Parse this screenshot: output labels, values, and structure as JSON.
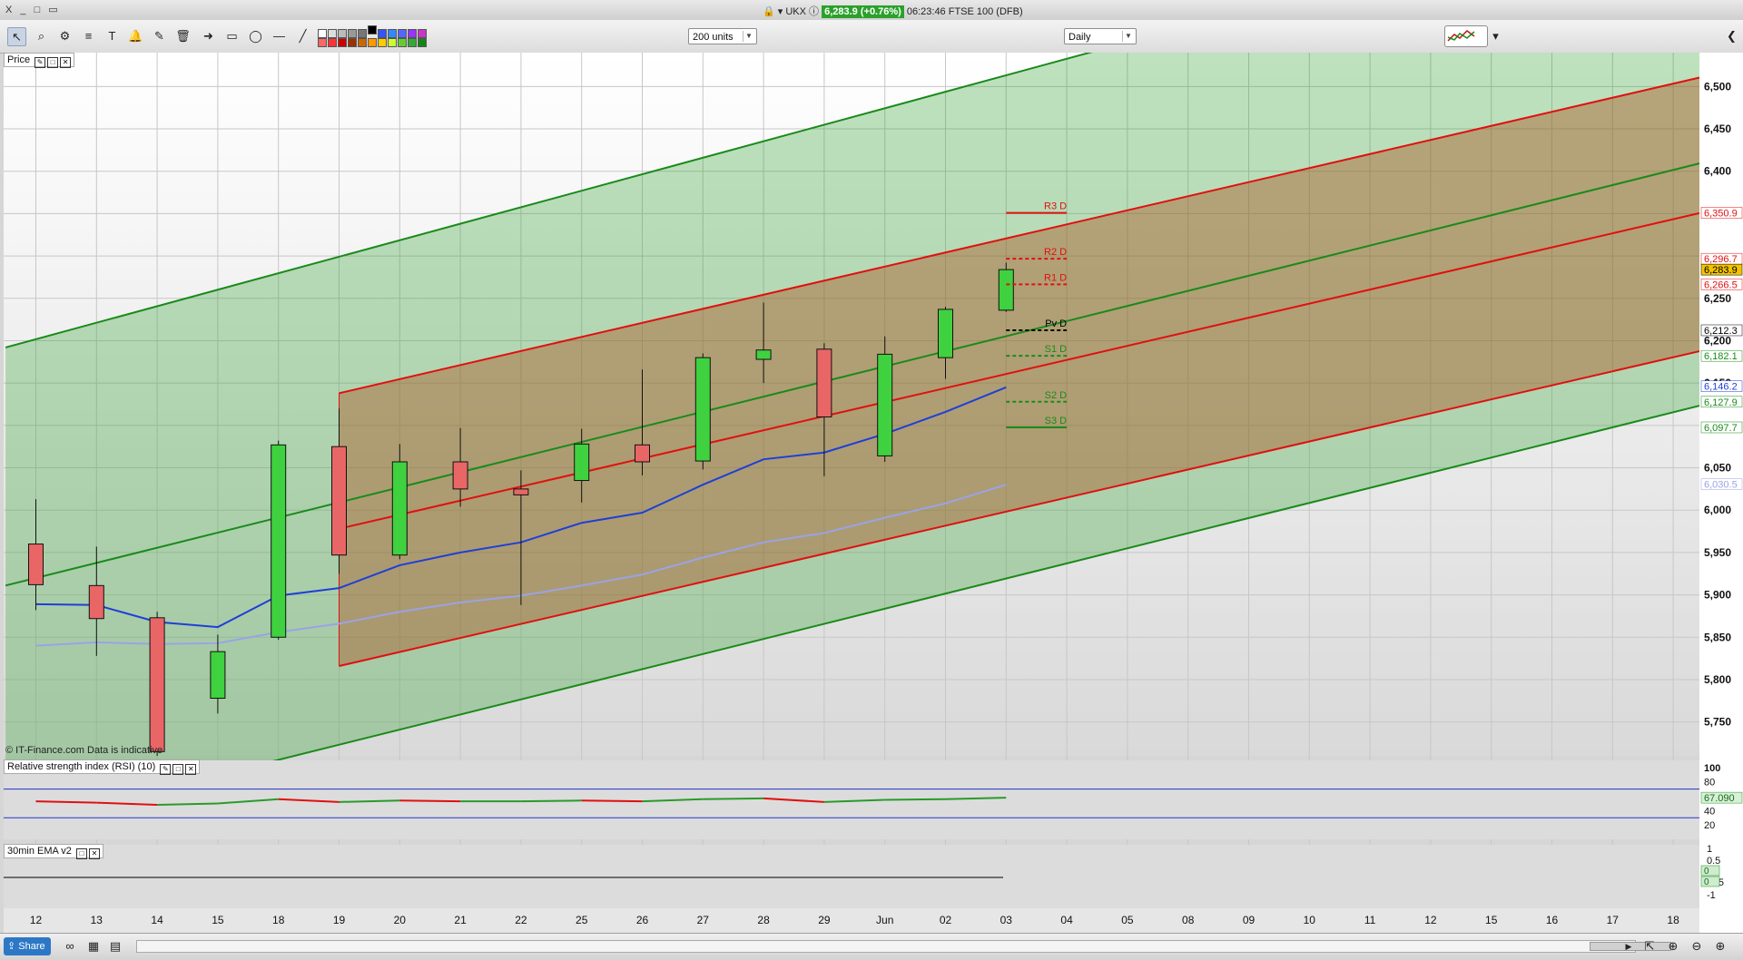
{
  "window": {
    "controls": "X _ □ ▭",
    "symbol": "UKX",
    "price_badge": "6,283.9 (+0.76%)",
    "clock_instrument": "06:23:46 FTSE 100 (DFB)"
  },
  "toolbar": {
    "units_select": "200 units",
    "interval_select": "Daily"
  },
  "panels": {
    "price_label": "Price",
    "rsi_label": "Relative strength index (RSI) (10)",
    "ema_label": "30min EMA v2",
    "copyright": "© IT-Finance.com  Data is indicative"
  },
  "bottom": {
    "share_label": "Share"
  },
  "colors": {
    "up": "#3fd13f",
    "down": "#e86666",
    "channel_red": "#e01010",
    "channel_green": "#1a8a1a",
    "ema_fast": "#1f3fd6",
    "ema_slow": "#9aa3e6",
    "rsi_up": "#2a9a2a",
    "rsi_down": "#e01010"
  },
  "chart_data": {
    "type": "candlestick",
    "x_ticks": [
      "12",
      "13",
      "14",
      "15",
      "18",
      "19",
      "20",
      "21",
      "22",
      "25",
      "26",
      "27",
      "28",
      "29",
      "Jun",
      "02",
      "03",
      "04",
      "05",
      "08",
      "09",
      "10",
      "11",
      "12",
      "15",
      "16",
      "17",
      "18"
    ],
    "y_ticks": [
      5750,
      5800,
      5850,
      5900,
      5950,
      6000,
      6050,
      6100,
      6150,
      6200,
      6250,
      6300,
      6350,
      6400,
      6450,
      6500
    ],
    "y_tick_labels": [
      "5,750",
      "5,800",
      "5,850",
      "5,900",
      "5,950",
      "6,000",
      "6,050",
      "",
      "6,150",
      "6,200",
      "6,250",
      "",
      "",
      "6,400",
      "6,450",
      "6,500"
    ],
    "ylim": [
      5710,
      6540
    ],
    "candles": [
      {
        "x": "12",
        "open": 5960,
        "high": 6013,
        "low": 5882,
        "close": 5912
      },
      {
        "x": "13",
        "open": 5911,
        "high": 5957,
        "low": 5828,
        "close": 5872
      },
      {
        "x": "14",
        "open": 5873,
        "high": 5880,
        "low": 5710,
        "close": 5715
      },
      {
        "x": "15",
        "open": 5778,
        "high": 5853,
        "low": 5760,
        "close": 5833
      },
      {
        "x": "18",
        "open": 5850,
        "high": 6082,
        "low": 5847,
        "close": 6077
      },
      {
        "x": "19",
        "open": 6075,
        "high": 6120,
        "low": 5925,
        "close": 5947
      },
      {
        "x": "20",
        "open": 5947,
        "high": 6078,
        "low": 5942,
        "close": 6057
      },
      {
        "x": "21",
        "open": 6057,
        "high": 6097,
        "low": 6004,
        "close": 6025
      },
      {
        "x": "22",
        "open": 6025,
        "high": 6047,
        "low": 5888,
        "close": 6018
      },
      {
        "x": "25",
        "open": 6035,
        "high": 6096,
        "low": 6009,
        "close": 6078
      },
      {
        "x": "26",
        "open": 6077,
        "high": 6166,
        "low": 6041,
        "close": 6057
      },
      {
        "x": "27",
        "open": 6058,
        "high": 6185,
        "low": 6048,
        "close": 6180
      },
      {
        "x": "28",
        "open": 6178,
        "high": 6245,
        "low": 6150,
        "close": 6189
      },
      {
        "x": "29",
        "open": 6190,
        "high": 6197,
        "low": 6040,
        "close": 6110
      },
      {
        "x": "Jun",
        "open": 6064,
        "high": 6205,
        "low": 6057,
        "close": 6184
      },
      {
        "x": "02",
        "open": 6180,
        "high": 6240,
        "low": 6155,
        "close": 6237
      },
      {
        "x": "03",
        "open": 6236,
        "high": 6292,
        "low": 6234,
        "close": 6283.9
      }
    ],
    "ema_fast": [
      5889,
      5888,
      5868,
      5862,
      5899,
      5908,
      5935,
      5950,
      5962,
      5985,
      5997,
      6030,
      6060,
      6068,
      6090,
      6116,
      6145
    ],
    "ema_slow": [
      5840,
      5844,
      5842,
      5843,
      5856,
      5866,
      5880,
      5891,
      5899,
      5911,
      5924,
      5944,
      5962,
      5973,
      5991,
      6008,
      6030
    ],
    "last_value_tags": [
      {
        "label": "6,350.9",
        "value": 6350.9,
        "bg": "#ffffff",
        "fg": "#e01010"
      },
      {
        "label": "6,296.7",
        "value": 6296.7,
        "bg": "#ffffff",
        "fg": "#e01010"
      },
      {
        "label": "6,283.9",
        "value": 6283.9,
        "bg": "#f2c300",
        "fg": "#000000"
      },
      {
        "label": "6,266.5",
        "value": 6266.5,
        "bg": "#ffffff",
        "fg": "#e01010"
      },
      {
        "label": "6,212.3",
        "value": 6212.3,
        "bg": "#ffffff",
        "fg": "#000000"
      },
      {
        "label": "6,182.1",
        "value": 6182.1,
        "bg": "#ffffff",
        "fg": "#1a8a1a"
      },
      {
        "label": "6,146.2",
        "value": 6146.2,
        "bg": "#ffffff",
        "fg": "#1f3fd6"
      },
      {
        "label": "6,127.9",
        "value": 6127.9,
        "bg": "#ffffff",
        "fg": "#1a8a1a"
      },
      {
        "label": "6,097.7",
        "value": 6097.7,
        "bg": "#ffffff",
        "fg": "#1a8a1a"
      },
      {
        "label": "6,030.5",
        "value": 6030.5,
        "bg": "#ffffff",
        "fg": "#9aa3e6"
      }
    ],
    "pivots": [
      {
        "label": "R3 D",
        "value": 6350.9,
        "color": "#e01010",
        "dash": false
      },
      {
        "label": "R2 D",
        "value": 6296.7,
        "color": "#e01010",
        "dash": true
      },
      {
        "label": "R1 D",
        "value": 6266.5,
        "color": "#e01010",
        "dash": true
      },
      {
        "label": "Pv D",
        "value": 6212.3,
        "color": "#000000",
        "dash": true
      },
      {
        "label": "S1 D",
        "value": 6182.1,
        "color": "#1a8a1a",
        "dash": true
      },
      {
        "label": "S2 D",
        "value": 6127.9,
        "color": "#1a8a1a",
        "dash": true
      },
      {
        "label": "S3 D",
        "value": 6097.7,
        "color": "#1a8a1a",
        "dash": false
      }
    ],
    "rsi": {
      "y_ticks": [
        20,
        40,
        60,
        80,
        100
      ],
      "ylim": [
        0,
        110
      ],
      "bands": [
        30,
        70
      ],
      "values": [
        53,
        51,
        48,
        50,
        56,
        52,
        54,
        53,
        53,
        54,
        53,
        56,
        57,
        52,
        55,
        56,
        58
      ],
      "last_label": "67.090"
    },
    "ema_osc": {
      "y_ticks": [
        "1",
        "0.5",
        "0",
        "-0.5",
        "-1"
      ],
      "last_labels": [
        "0",
        "0"
      ]
    }
  }
}
